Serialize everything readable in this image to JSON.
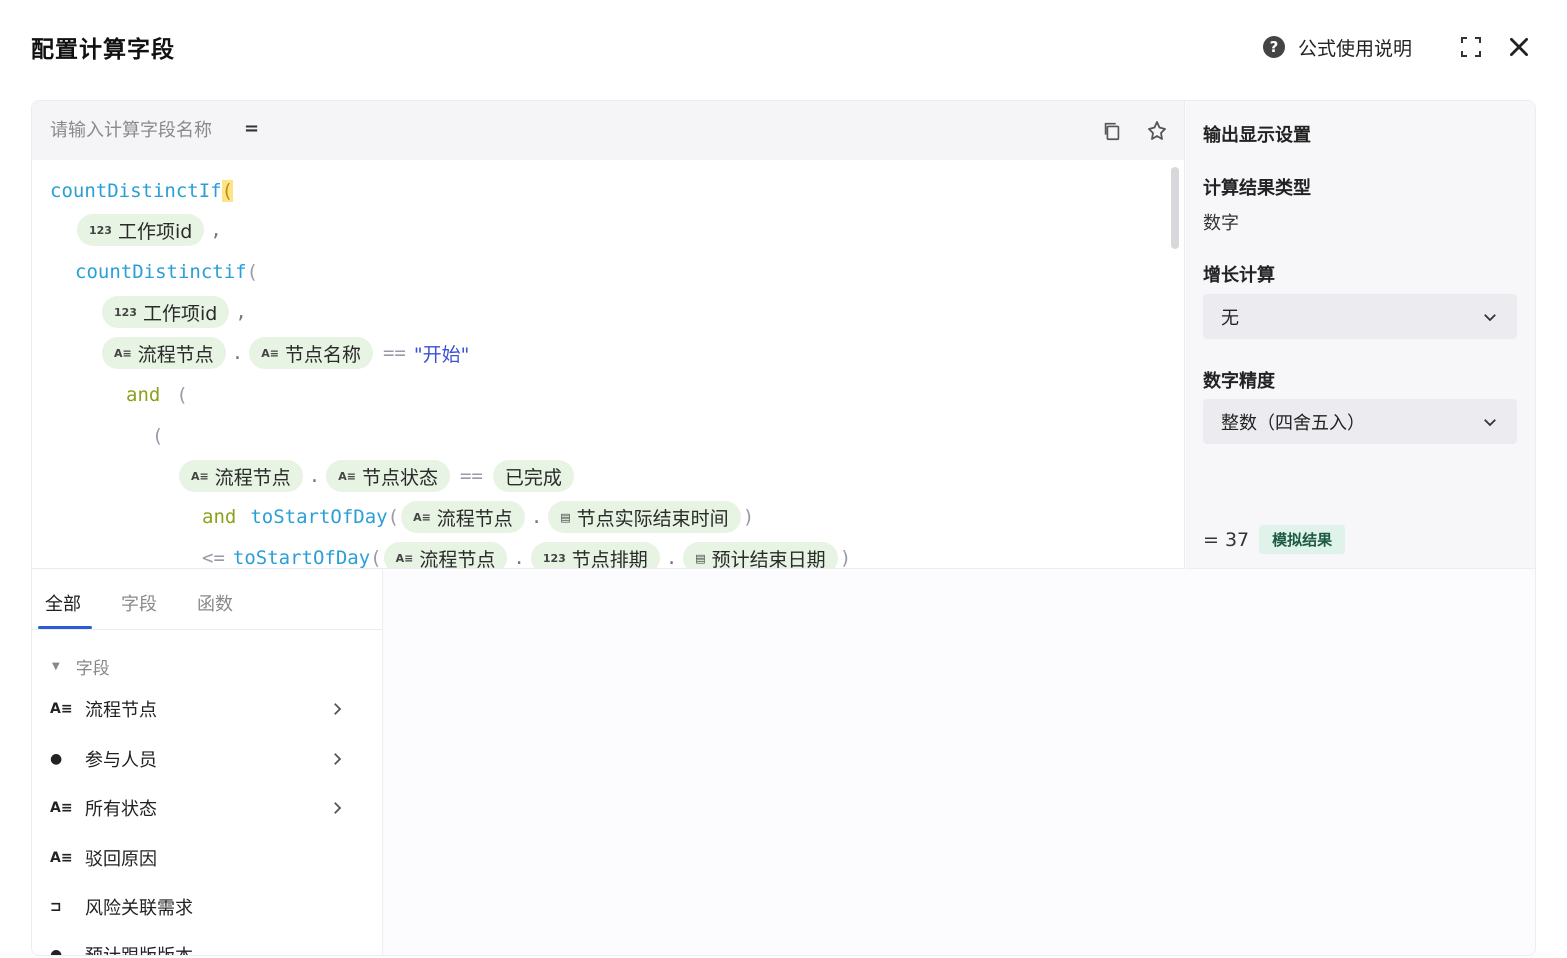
{
  "dialog": {
    "title": "配置计算字段",
    "help_label": "公式使用说明",
    "help_icon": "question-circle-icon",
    "fullscreen_icon": "expand-icon",
    "close_icon": "close-icon"
  },
  "editor": {
    "name_placeholder": "请输入计算字段名称",
    "eq": "=",
    "copy_icon": "copy-icon",
    "format_icon": "magic-icon",
    "code": {
      "fn_count_distinct_if_1": "countDistinctIf",
      "fn_count_distinct_if_2": "countDistinctif",
      "fn_to_start_of_day": "toStartOfDay",
      "kw_and": "and",
      "op_eq": "==",
      "op_le": "<=",
      "str_start": "\"开始\"",
      "chip_workitem_id": "工作项id",
      "chip_flow_node": "流程节点",
      "chip_node_name": "节点名称",
      "chip_node_status": "节点状态",
      "chip_completed": "已完成",
      "chip_actual_end": "节点实际结束时间",
      "chip_node_schedule": "节点排期",
      "chip_est_end": "预计结束日期",
      "chip_icon_num": "123",
      "chip_icon_text": "A≡",
      "chip_icon_date": "▤"
    }
  },
  "settings": {
    "title": "输出显示设置",
    "result_type_label": "计算结果类型",
    "result_type_value": "数字",
    "growth_label": "增长计算",
    "growth_value": "无",
    "precision_label": "数字精度",
    "precision_value": "整数（四舍五入）",
    "result_value": "= 37",
    "result_badge": "模拟结果"
  },
  "fields": {
    "tabs": [
      "全部",
      "字段",
      "函数"
    ],
    "group_label": "字段",
    "items": [
      {
        "label": "流程节点",
        "icon": "A≡",
        "has_children": true
      },
      {
        "label": "参与人员",
        "icon": "●",
        "has_children": true
      },
      {
        "label": "所有状态",
        "icon": "A≡",
        "has_children": true
      },
      {
        "label": "驳回原因",
        "icon": "A≡",
        "has_children": false
      },
      {
        "label": "风险关联需求",
        "icon": "⊐",
        "has_children": false
      },
      {
        "label": "预计跟版版本",
        "icon": "●",
        "has_children": false
      }
    ]
  }
}
